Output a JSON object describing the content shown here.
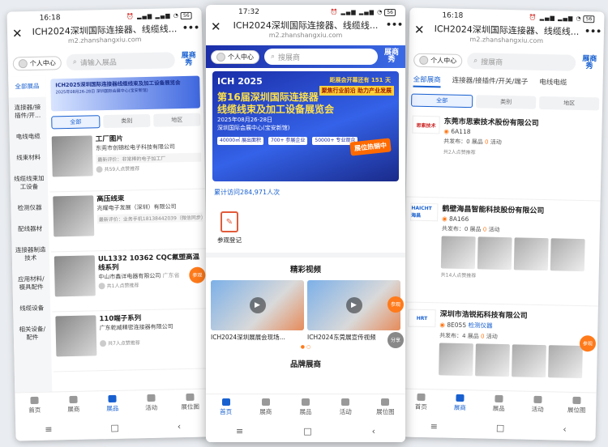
{
  "common": {
    "status_icons": "⏰ ▂▄▆ ▂▄▆ ◔",
    "battery": "56",
    "title": "ICH2024深圳国际连接器、线缆线...",
    "url": "m2.zhanshangxiu.com",
    "close": "✕",
    "more": "•••",
    "user_center": "个人中心",
    "logo": "展商秀",
    "tabs": [
      "首页",
      "展商",
      "展品",
      "活动",
      "展位图"
    ],
    "nav": [
      "≡",
      "□",
      "‹"
    ]
  },
  "p1": {
    "time": "16:18",
    "search_placeholder": "请输入展品",
    "side": [
      "全部展品",
      "连接器/接插件/开...",
      "电线电缆",
      "线束材料",
      "线缆线束加工设备",
      "检测仪器",
      "配线器材",
      "连接器制造技术",
      "应用材料/模具配件",
      "线缆设备",
      "相关设备/配件"
    ],
    "banner_title": "ICH2025深圳国际连接器线缆线束及加工设备展览会",
    "banner_sub": "2025年08月26-28日 深圳国际会展中心(宝安新馆)",
    "filters": [
      "全部",
      "类别",
      "地区"
    ],
    "products": [
      {
        "name": "工厂图片",
        "co": "东莞市创锦松电子科技有限公司",
        "eval": "最新评价：非常棒的电子加工厂",
        "rec": "共59人点赞推荐"
      },
      {
        "name": "高压线束",
        "co": "兆耀电子发展（深圳）有限公司",
        "eval": "最新评价：业务手机18138442039（微信同步）",
        "rec": ""
      },
      {
        "name": "UL1332 10362 CQC氟塑高温线系列",
        "co": "中山市鑫详电器有限公司",
        "region": "广东省",
        "rec": "共1人点赞推荐"
      },
      {
        "name": "110端子系列",
        "co": "广东乾威精密连接器有限公司",
        "rec": "共7人点赞推荐"
      }
    ],
    "float_btn": "参观"
  },
  "p2": {
    "time": "17:32",
    "search_placeholder": "搜展商",
    "banner": {
      "logo": "ICH 2025",
      "tag": "距展会开幕还有 151 天",
      "tag2": "聚焦行业前沿 助力产业发展",
      "t1": "第16届深圳国际连接器",
      "t2": "线缆线束及加工设备展览会",
      "date": "2025年08月26-28日",
      "venue": "深圳国际会展中心(宝安新馆)",
      "hot": "展位热销中",
      "stats": [
        "40000㎡ 展出面积",
        "700+ 参展企业",
        "50000+ 专业观众"
      ]
    },
    "visits": "累计访问284,971人次",
    "register": "参观登记",
    "video_section": "精彩视频",
    "videos": [
      "ICH2024深圳展展会现场...",
      "ICH2024东莞展宣传视频"
    ],
    "share": "分享",
    "next_section": "品牌展商"
  },
  "p3": {
    "time": "16:18",
    "search_placeholder": "搜展商",
    "tabs": [
      "全部展商",
      "连接器/接插件/开关/端子",
      "电线电缆"
    ],
    "filters": [
      "全部",
      "类别",
      "地区"
    ],
    "companies": [
      {
        "logo": "思索技术",
        "name": "东莞市思索技术股份有限公司",
        "booth": "6A118",
        "published": "共发布：0",
        "products": "展品",
        "events": "0",
        "events_label": "活动",
        "rec": "共2人点赞推荐"
      },
      {
        "logo": "HAICHT 海昌",
        "name": "鹤壁海昌智能科技股份有限公司",
        "booth": "8A166",
        "published": "共发布：0",
        "products": "展品",
        "events": "0",
        "events_label": "活动",
        "rec": "共14人点赞推荐"
      },
      {
        "logo": "HRT",
        "name": "深圳市浩锐拓科技有限公司",
        "booth": "8E055",
        "category": "检测仪器",
        "published": "共发布：4",
        "products": "展品",
        "events": "0",
        "events_label": "活动",
        "rec": ""
      }
    ],
    "float_btn": "参观"
  },
  "colors": {
    "accent": "#1860d0",
    "orange": "#ff7a1a"
  }
}
